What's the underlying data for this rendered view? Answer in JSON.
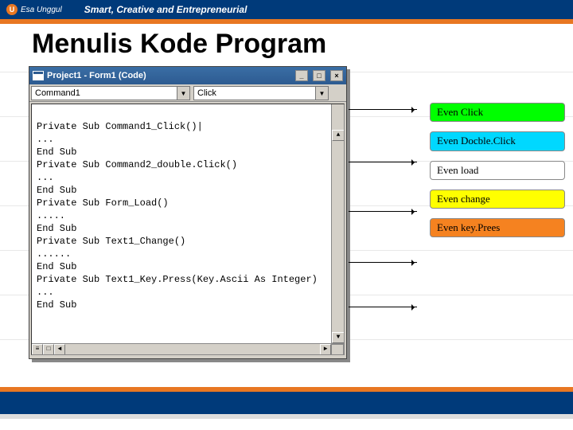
{
  "header": {
    "brand": "Esa Unggul",
    "tagline": "Smart, Creative and Entrepreneurial"
  },
  "slide": {
    "title": "Menulis Kode Program"
  },
  "window": {
    "title": "Project1 - Form1 (Code)",
    "object_dropdown": "Command1",
    "procedure_dropdown": "Click"
  },
  "code": {
    "lines": [
      "Private Sub Command1_Click()|",
      "...",
      "End Sub",
      "Private Sub Command2_double.Click()",
      "...",
      "End Sub",
      "Private Sub Form_Load()",
      ".....",
      "End Sub",
      "Private Sub Text1_Change()",
      "......",
      "End Sub",
      "Private Sub Text1_Key.Press(Key.Ascii As Integer)",
      "...",
      "End Sub"
    ]
  },
  "callouts": [
    {
      "label": "Even Click",
      "color": "c-green"
    },
    {
      "label": "Even Docble.Click",
      "color": "c-cyan"
    },
    {
      "label": "Even load",
      "color": "c-white"
    },
    {
      "label": "Even change",
      "color": "c-yellow"
    },
    {
      "label": "Even key.Prees",
      "color": "c-orange"
    }
  ]
}
